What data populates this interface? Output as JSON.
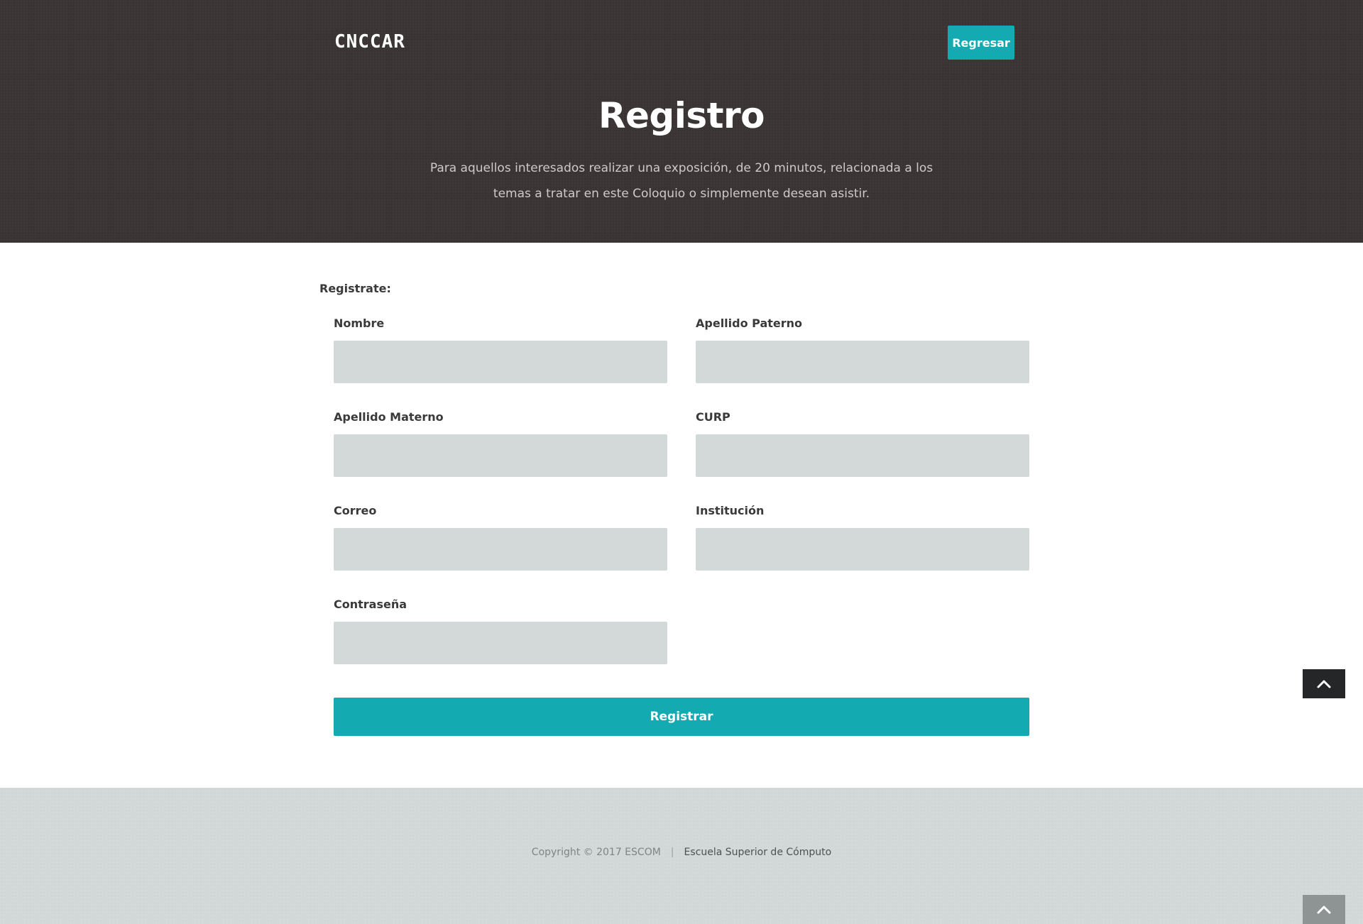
{
  "header": {
    "logo": "CNCCAR",
    "back_label": "Regresar",
    "title": "Registro",
    "description": "Para aquellos interesados realizar una exposición, de 20 minutos, relacionada a los temas a tratar en este Coloquio o simplemente desean asistir."
  },
  "form": {
    "heading": "Registrate:",
    "fields": {
      "nombre": {
        "label": "Nombre",
        "value": ""
      },
      "apellido_paterno": {
        "label": "Apellido Paterno",
        "value": ""
      },
      "apellido_materno": {
        "label": "Apellido Materno",
        "value": ""
      },
      "curp": {
        "label": "CURP",
        "value": ""
      },
      "correo": {
        "label": "Correo",
        "value": ""
      },
      "institucion": {
        "label": "Institución",
        "value": ""
      },
      "contrasena": {
        "label": "Contraseña",
        "value": ""
      }
    },
    "submit_label": "Registrar"
  },
  "footer": {
    "copyright": "Copyright © 2017 ESCOM",
    "separator": "|",
    "link": "Escuela Superior de Cómputo"
  },
  "icons": {
    "scroll_top": "chevron-up-icon"
  },
  "colors": {
    "accent": "#14aab1",
    "header_bg": "#3a3434",
    "input_bg": "#d3d9d9",
    "footer_bg": "#d3d9d9"
  }
}
